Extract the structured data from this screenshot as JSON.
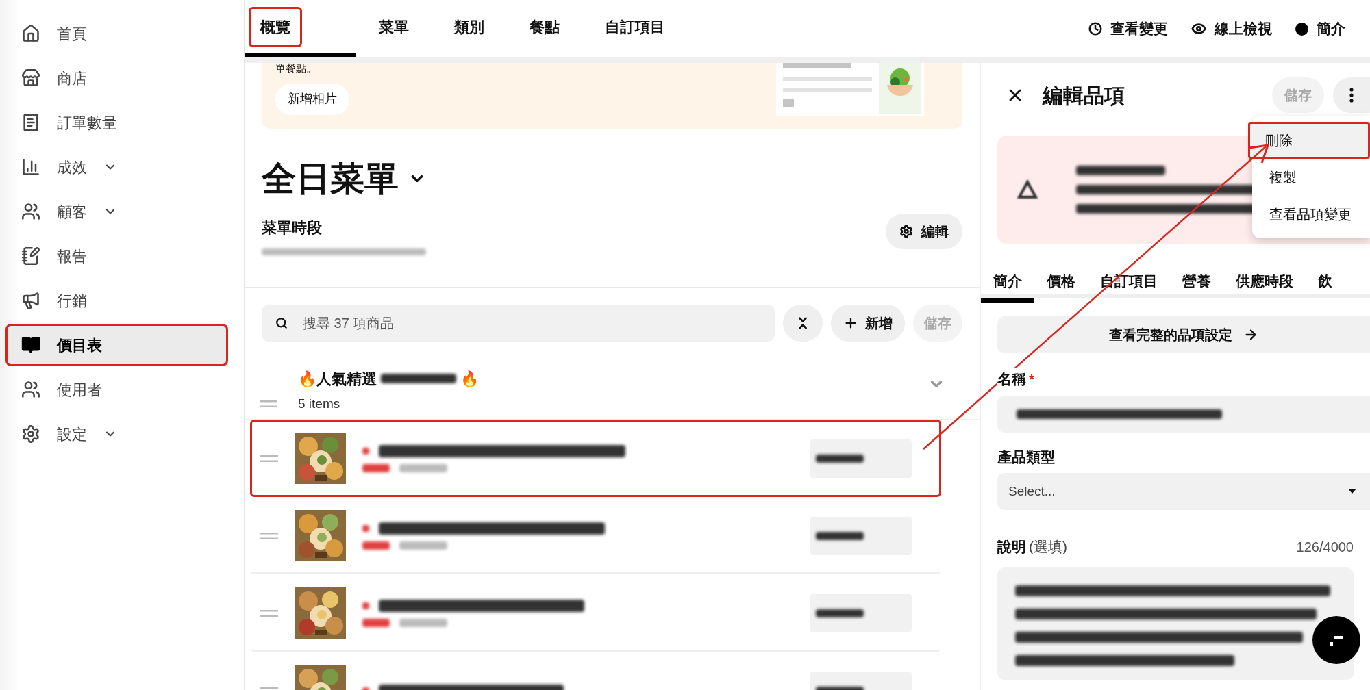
{
  "sidebar": {
    "items": [
      {
        "label": "首頁",
        "selected": false,
        "expandable": false,
        "highlighted": false
      },
      {
        "label": "商店",
        "selected": false,
        "expandable": false,
        "highlighted": false
      },
      {
        "label": "訂單數量",
        "selected": false,
        "expandable": false,
        "highlighted": false
      },
      {
        "label": "成效",
        "selected": false,
        "expandable": true,
        "highlighted": false
      },
      {
        "label": "顧客",
        "selected": false,
        "expandable": true,
        "highlighted": false
      },
      {
        "label": "報告",
        "selected": false,
        "expandable": false,
        "highlighted": false
      },
      {
        "label": "行銷",
        "selected": false,
        "expandable": false,
        "highlighted": false
      },
      {
        "label": "價目表",
        "selected": true,
        "expandable": false,
        "highlighted": true
      },
      {
        "label": "使用者",
        "selected": false,
        "expandable": false,
        "highlighted": false
      },
      {
        "label": "設定",
        "selected": false,
        "expandable": true,
        "highlighted": false
      }
    ]
  },
  "header": {
    "tabs": [
      {
        "label": "概覽",
        "selected": true,
        "highlighted": true
      },
      {
        "label": "菜單",
        "selected": false,
        "highlighted": false
      },
      {
        "label": "類別",
        "selected": false,
        "highlighted": false
      },
      {
        "label": "餐點",
        "selected": false,
        "highlighted": false
      },
      {
        "label": "自訂項目",
        "selected": false,
        "highlighted": false
      }
    ],
    "actions": [
      {
        "label": "查看變更"
      },
      {
        "label": "線上檢視"
      },
      {
        "label": "簡介"
      }
    ]
  },
  "banner": {
    "text": "單餐點。",
    "button": "新增相片"
  },
  "menu": {
    "title": "全日菜單",
    "section_label": "菜單時段",
    "edit_button": "編輯"
  },
  "toolbar": {
    "search": {
      "placeholder": "搜尋 37 項商品"
    },
    "add_button": "新增",
    "save_button": {
      "label": "儲存",
      "disabled": true
    }
  },
  "category": {
    "title_start": "🔥人氣精選",
    "title_end": "🔥",
    "count": "5 items"
  },
  "rows": [
    {
      "highlighted": true
    },
    {
      "highlighted": false
    },
    {
      "highlighted": false
    },
    {
      "highlighted": false
    }
  ],
  "panel": {
    "title": "編輯品項",
    "save_button": {
      "label": "儲存",
      "disabled": true
    },
    "menu_items": [
      {
        "label": "刪除",
        "selected": true,
        "highlighted": true
      },
      {
        "label": "複製",
        "selected": false,
        "highlighted": false
      },
      {
        "label": "查看品項變更",
        "selected": false,
        "highlighted": false
      }
    ],
    "tabs": [
      {
        "label": "簡介",
        "selected": true
      },
      {
        "label": "價格",
        "selected": false
      },
      {
        "label": "自訂項目",
        "selected": false
      },
      {
        "label": "營養",
        "selected": false
      },
      {
        "label": "供應時段",
        "selected": false
      },
      {
        "label": "飲",
        "selected": false
      }
    ],
    "full_settings_button": "查看完整的品項設定",
    "name_label": "名稱",
    "name_required_mark": "*",
    "type_label": "產品類型",
    "type_placeholder": "Select...",
    "desc_label": "說明",
    "desc_optional": "(選填)",
    "desc_count": "126/4000"
  }
}
